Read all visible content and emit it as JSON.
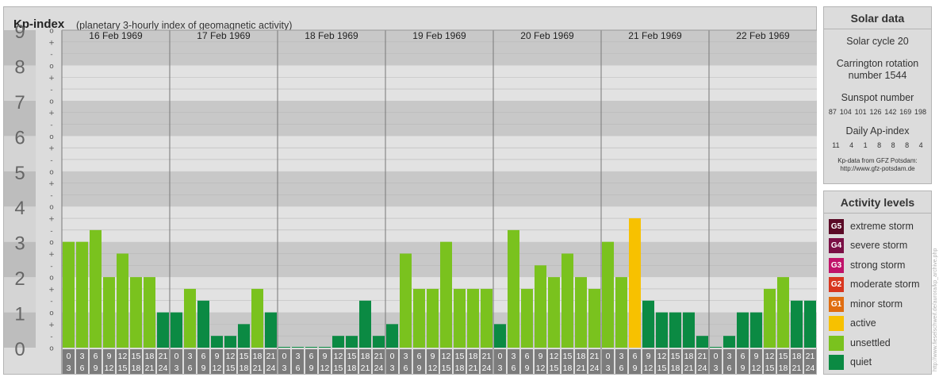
{
  "header": {
    "title": "Kp-index",
    "subtitle": "(planetary 3-hourly index of geomagnetic activity)"
  },
  "chart_data": {
    "type": "bar",
    "title": "Kp-index",
    "subtitle": "(planetary 3-hourly index of geomagnetic activity)",
    "ylim": [
      0,
      9
    ],
    "y_major_ticks": [
      "0",
      "1",
      "2",
      "3",
      "4",
      "5",
      "6",
      "7",
      "8",
      "9"
    ],
    "y_minor_ticks": [
      "+",
      "o",
      "-"
    ],
    "days": [
      "16 Feb 1969",
      "17 Feb 1969",
      "18 Feb 1969",
      "19 Feb 1969",
      "20 Feb 1969",
      "21 Feb 1969",
      "22 Feb 1969"
    ],
    "hour_start_labels": [
      "0",
      "3",
      "6",
      "9",
      "12",
      "15",
      "18",
      "21"
    ],
    "hour_end_labels": [
      "3",
      "6",
      "9",
      "12",
      "15",
      "18",
      "21",
      "24"
    ],
    "values": [
      [
        3.0,
        3.0,
        3.333,
        2.0,
        2.667,
        2.0,
        2.0,
        1.0
      ],
      [
        1.0,
        1.667,
        1.333,
        0.333,
        0.333,
        0.667,
        1.667,
        1.0
      ],
      [
        0.0,
        0.0,
        0.0,
        0.0,
        0.333,
        0.333,
        1.333,
        0.333
      ],
      [
        0.667,
        2.667,
        1.667,
        1.667,
        3.0,
        1.667,
        1.667,
        1.667
      ],
      [
        0.667,
        3.333,
        1.667,
        2.333,
        2.0,
        2.667,
        2.0,
        1.667
      ],
      [
        3.0,
        2.0,
        3.667,
        1.333,
        1.0,
        1.0,
        1.0,
        0.333
      ],
      [
        0.0,
        0.333,
        1.0,
        1.0,
        1.667,
        2.0,
        1.333,
        1.333
      ]
    ],
    "colors": {
      "quiet": "#0b8a43",
      "unsettled": "#7ac21e",
      "active": "#f7c100",
      "axis_label_box": "#7c7c7c",
      "band_dark": "#c8c8c8",
      "band_light": "#e2e2e2"
    },
    "grid": true
  },
  "solar": {
    "title": "Solar data",
    "cycle": "Solar cycle 20",
    "carrington_line1": "Carrington rotation",
    "carrington_line2": "number 1544",
    "sunspot_title": "Sunspot number",
    "sunspot_values": [
      "87",
      "104",
      "101",
      "126",
      "142",
      "169",
      "198"
    ],
    "ap_title": "Daily Ap-index",
    "ap_values": [
      "11",
      "4",
      "1",
      "8",
      "8",
      "8",
      "4"
    ],
    "source_line1": "Kp-data from GFZ Potsdam:",
    "source_line2": "http://www.gfz-potsdam.de"
  },
  "activity": {
    "title": "Activity levels",
    "items": [
      {
        "badge": "G5",
        "label": "extreme storm",
        "color": "#5a0a26"
      },
      {
        "badge": "G4",
        "label": "severe storm",
        "color": "#7a0f45"
      },
      {
        "badge": "G3",
        "label": "strong storm",
        "color": "#c0136a"
      },
      {
        "badge": "G2",
        "label": "moderate storm",
        "color": "#d8361f"
      },
      {
        "badge": "G1",
        "label": "minor storm",
        "color": "#e06d10"
      },
      {
        "badge": "",
        "label": "active",
        "color": "#f7c100"
      },
      {
        "badge": "",
        "label": "unsettled",
        "color": "#7ac21e"
      },
      {
        "badge": "",
        "label": "quiet",
        "color": "#0b8a43"
      }
    ]
  },
  "credit": "http://www.fieselschweif.de/aurora/kp_archive.php"
}
